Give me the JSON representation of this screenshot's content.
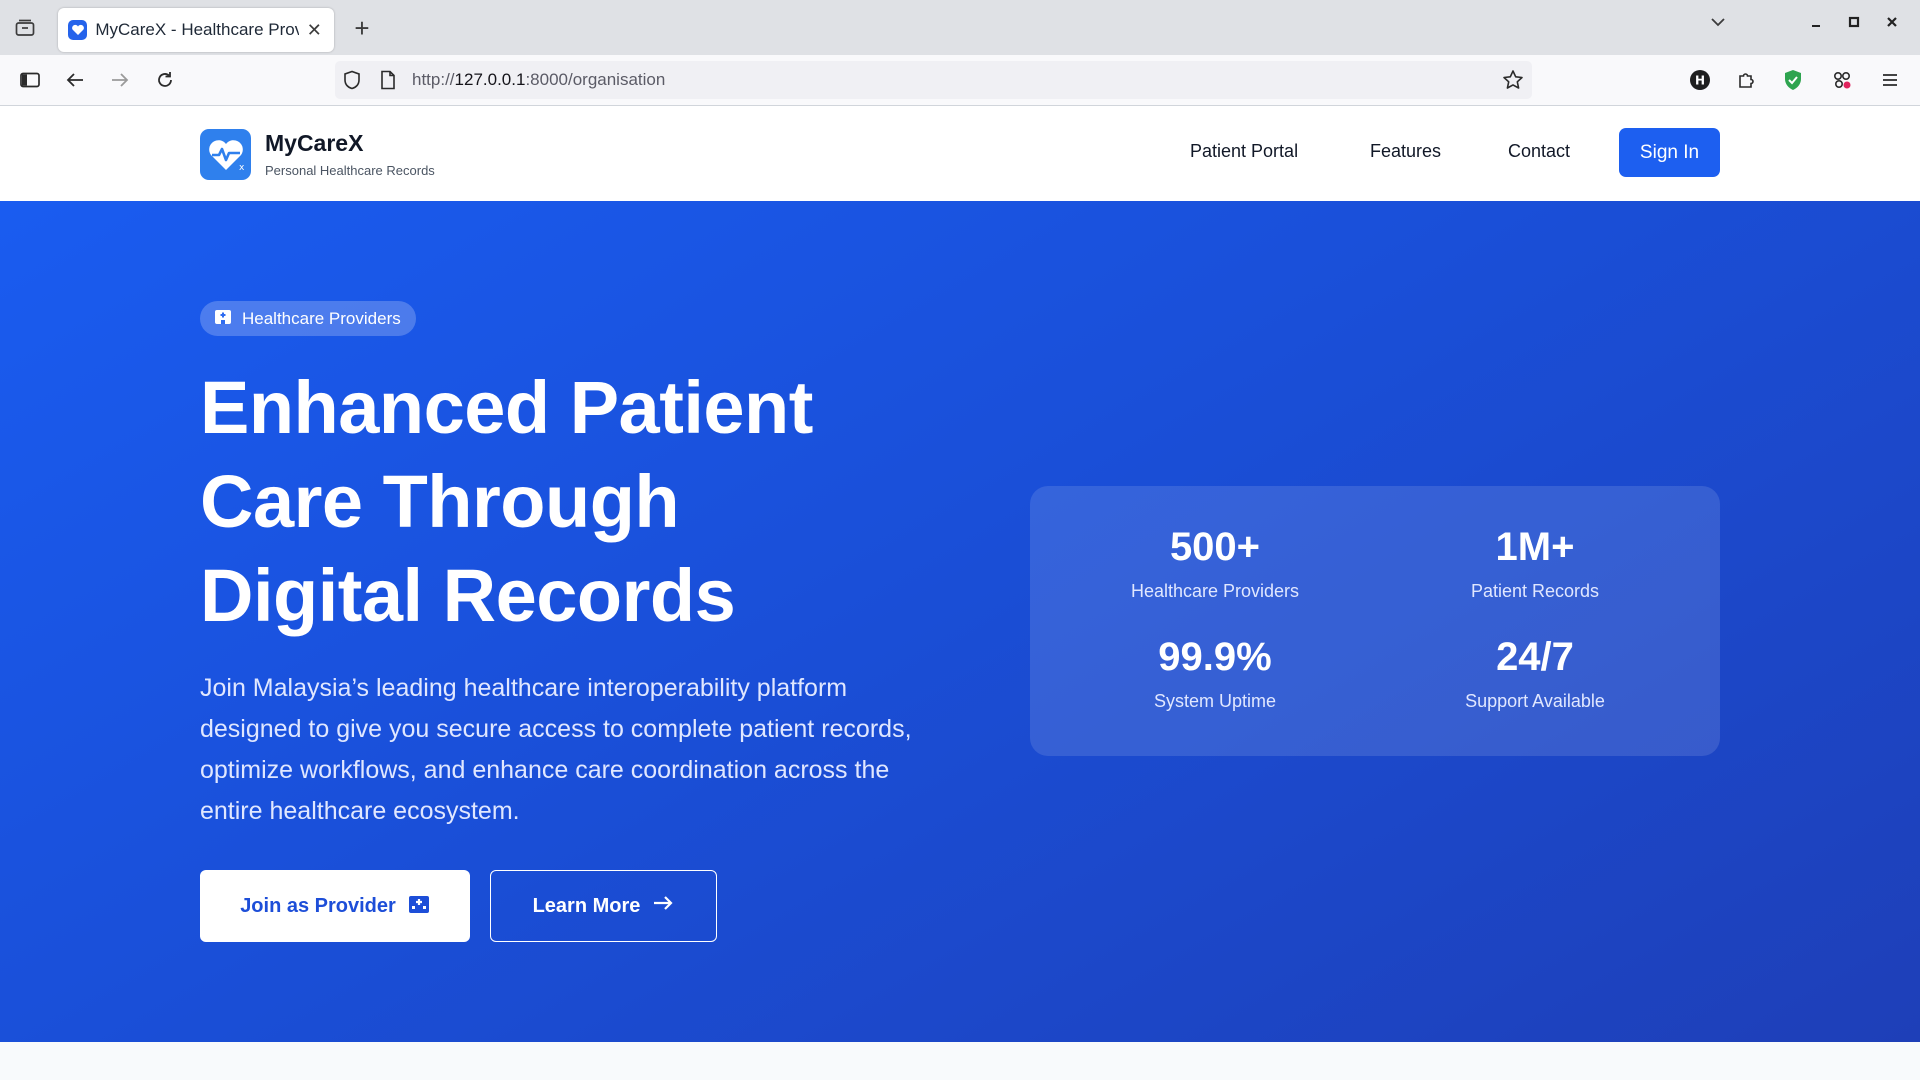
{
  "browser": {
    "tab_title": "MyCareX - Healthcare Prov",
    "tab_close": "✕",
    "new_tab": "+",
    "url_prefix": "http://",
    "url_host": "127.0.0.1",
    "url_path": ":8000/organisation"
  },
  "header": {
    "brand_name": "MyCareX",
    "brand_tagline": "Personal Healthcare Records",
    "nav": [
      "Patient Portal",
      "Features",
      "Contact"
    ],
    "sign_in": "Sign In"
  },
  "hero": {
    "badge": "Healthcare Providers",
    "title_lines": [
      "Enhanced Patient",
      "Care Through",
      "Digital Records"
    ],
    "description": "Join Malaysia’s leading healthcare interoperability platform designed to give you secure access to complete patient records, optimize workflows, and enhance care coordination across the entire healthcare ecosystem.",
    "primary_button": "Join as Provider",
    "secondary_button": "Learn More"
  },
  "stats": [
    {
      "value": "500+",
      "label": "Healthcare Providers"
    },
    {
      "value": "1M+",
      "label": "Patient Records"
    },
    {
      "value": "99.9%",
      "label": "System Uptime"
    },
    {
      "value": "24/7",
      "label": "Support Available"
    }
  ],
  "colors": {
    "accent": "#1d5ff0",
    "hero_start": "#1a5cf0",
    "hero_end": "#1e3fb8"
  }
}
